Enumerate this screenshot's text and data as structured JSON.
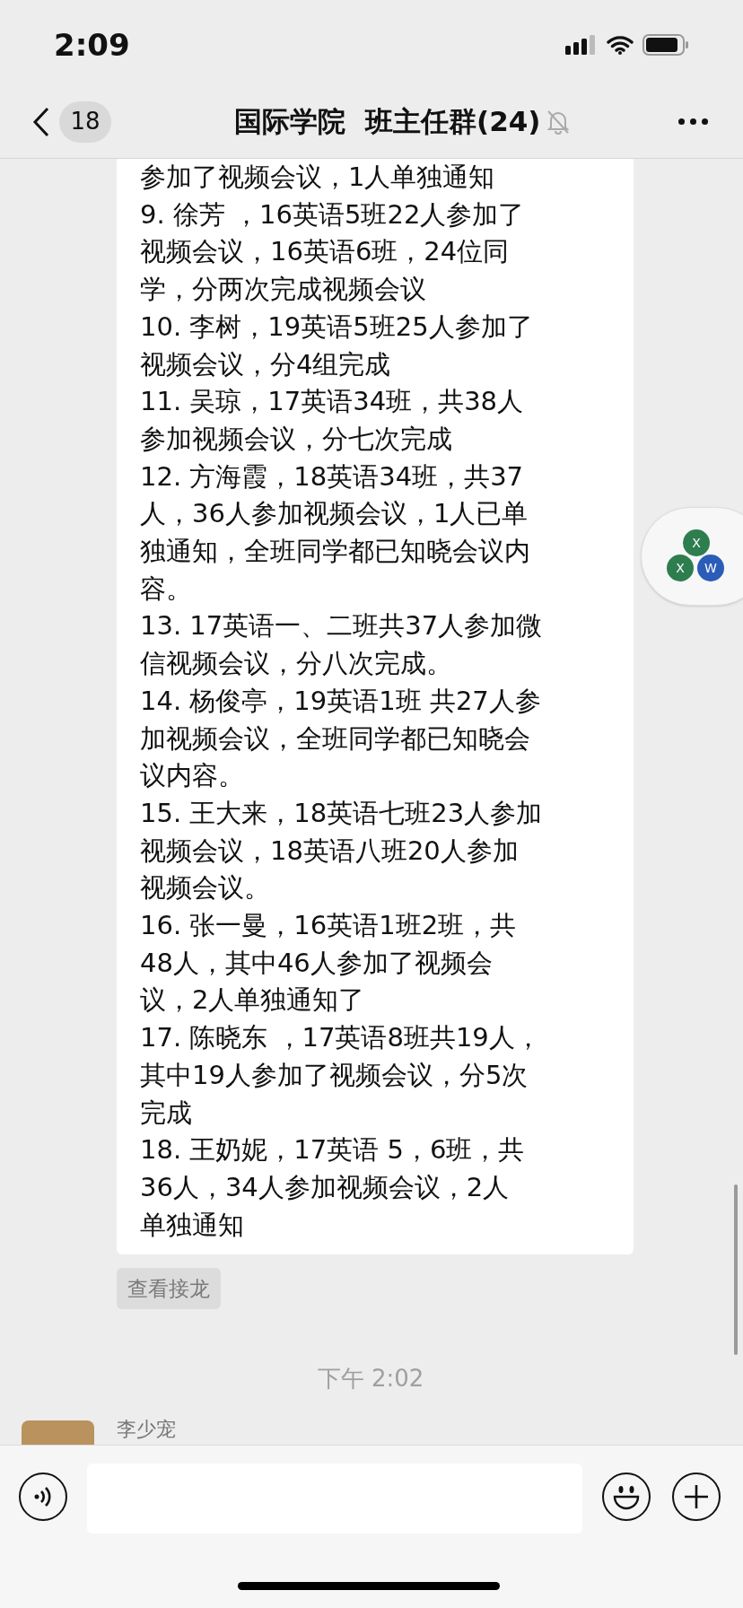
{
  "status_bar": {
    "time": "2:09"
  },
  "header": {
    "unread_count": "18",
    "title": "国际学院  班主任群(24)",
    "muted": true
  },
  "message": {
    "items": [
      {
        "lines": [
          "参加了视频会议，1人单独通知"
        ]
      },
      {
        "lines": [
          "9. 徐芳 ，16英语5班22人参加了",
          "视频会议，16英语6班，24位同",
          "学，分两次完成视频会议"
        ]
      },
      {
        "lines": [
          "10. 李树，19英语5班25人参加了",
          "视频会议，分4组完成"
        ]
      },
      {
        "lines": [
          "11. 吴琼，17英语34班，共38人",
          "参加视频会议，分七次完成"
        ]
      },
      {
        "lines": [
          "12. 方海霞，18英语34班，共37",
          "人，36人参加视频会议，1人已单",
          "独通知，全班同学都已知晓会议内",
          "容。"
        ]
      },
      {
        "lines": [
          "13. 17英语一、二班共37人参加微",
          "信视频会议，分八次完成。"
        ]
      },
      {
        "lines": [
          "14. 杨俊亭，19英语1班 共27人参",
          "加视频会议，全班同学都已知晓会",
          "议内容。"
        ]
      },
      {
        "lines": [
          "15. 王大来，18英语七班23人参加",
          "视频会议，18英语八班20人参加",
          "视频会议。"
        ]
      },
      {
        "lines": [
          "16. 张一曼，16英语1班2班，共",
          "48人，其中46人参加了视频会",
          "议，2人单独通知了"
        ]
      },
      {
        "lines": [
          "17. 陈晓东 ，17英语8班共19人，",
          "其中19人参加了视频会议，分5次",
          "完成"
        ]
      },
      {
        "lines": [
          "18. 王奶妮，17英语 5，6班，共",
          "36人，34人参加视频会议，2人",
          "单独通知"
        ]
      }
    ],
    "action": "查看接龙"
  },
  "timestamp": "下午 2:02",
  "next_message": {
    "sender": "李少宠"
  },
  "floating_widget": {
    "letters": [
      "X",
      "X",
      "W"
    ]
  }
}
